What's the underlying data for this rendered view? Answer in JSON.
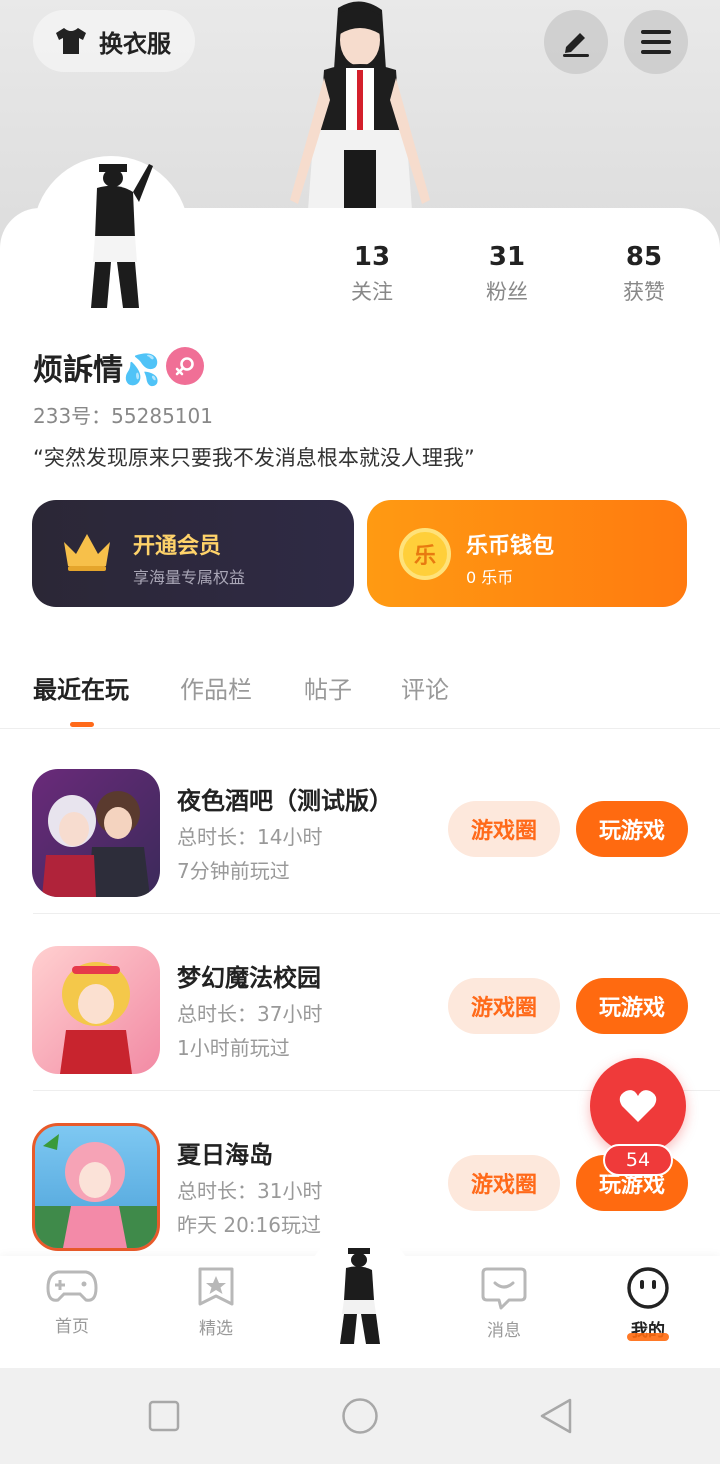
{
  "header": {
    "outfit_label": "换衣服",
    "edit_icon": "pencil-icon",
    "menu_icon": "hamburger-menu-icon"
  },
  "stats": [
    {
      "value": "13",
      "label": "关注"
    },
    {
      "value": "31",
      "label": "粉丝"
    },
    {
      "value": "85",
      "label": "获赞"
    }
  ],
  "profile": {
    "name": "烦訴情💦",
    "uid": "233号：55285101",
    "bio": "“突然发现原来只要我不发消息根本就没人理我”"
  },
  "vip": {
    "title": "开通会员",
    "subtitle": "享海量专属权益"
  },
  "wallet": {
    "title": "乐币钱包",
    "subtitle": "0 乐币",
    "coin_glyph": "乐"
  },
  "tabs": [
    "最近在玩",
    "作品栏",
    "帖子",
    "评论"
  ],
  "games": [
    {
      "name": "夜色酒吧（测试版）",
      "duration": "总时长：14小时",
      "last_played": "7分钟前玩过",
      "circle_label": "游戏圈",
      "play_label": "玩游戏"
    },
    {
      "name": "梦幻魔法校园",
      "duration": "总时长：37小时",
      "last_played": "1小时前玩过",
      "circle_label": "游戏圈",
      "play_label": "玩游戏"
    },
    {
      "name": "夏日海岛",
      "duration": "总时长：31小时",
      "last_played": "昨天 20:16玩过",
      "circle_label": "游戏圈",
      "play_label": "玩游戏"
    }
  ],
  "fab": {
    "badge": "54"
  },
  "bottom_nav": [
    {
      "label": "首页",
      "icon": "gamepad-icon"
    },
    {
      "label": "精选",
      "icon": "star-bookmark-icon"
    },
    {
      "label": "",
      "icon": "avatar-icon"
    },
    {
      "label": "消息",
      "icon": "chat-bubble-icon"
    },
    {
      "label": "我的",
      "icon": "face-icon"
    }
  ],
  "colors": {
    "accent": "#ff6a10",
    "vip_gold": "#ffd36a",
    "fab_red": "#ef3a3a"
  }
}
